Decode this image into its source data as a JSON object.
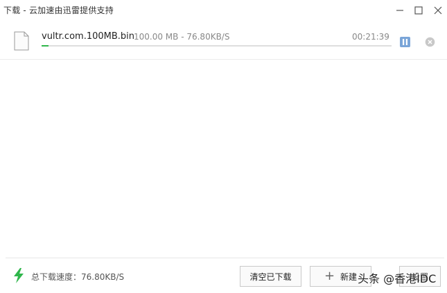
{
  "window": {
    "title": "下载 - 云加速由迅雷提供支持"
  },
  "download": {
    "filename": "vultr.com.100MB.bin",
    "size_speed": "100.00 MB - 76.80KB/S",
    "time_left": "00:21:39",
    "progress_percent": 2
  },
  "footer": {
    "total_speed": "总下载速度：76.80KB/S",
    "clear_label": "清空已下载",
    "new_label": "新建",
    "settings_label": "设置"
  },
  "watermark": {
    "text": "头条 @香港IDC"
  },
  "colors": {
    "progress": "#2fb64b",
    "pause_button": "#7aa5d8",
    "bolt": "#2fb64b"
  }
}
